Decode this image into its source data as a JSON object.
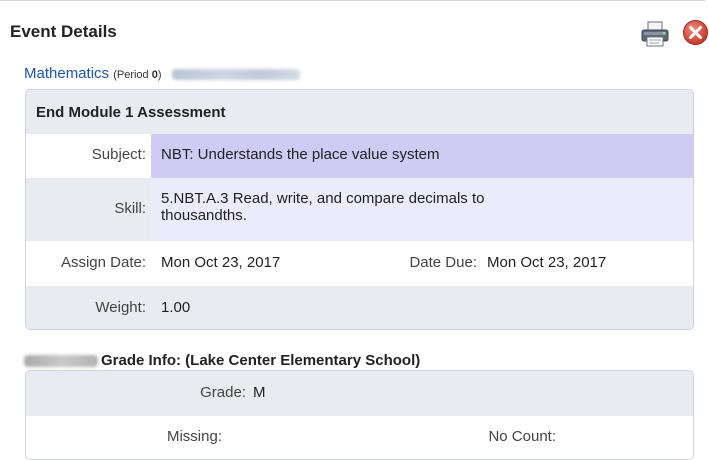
{
  "header": {
    "title": "Event Details",
    "icons": [
      "printer-icon",
      "close-icon"
    ]
  },
  "class_line": {
    "class_name": "Mathematics",
    "period_prefix": "(Period ",
    "period_number": "0",
    "period_suffix": ")"
  },
  "event": {
    "title": "End Module 1 Assessment",
    "subject_label": "Subject:",
    "subject_value": "NBT: Understands the place value system",
    "skill_label": "Skill:",
    "skill_value_line1": "5.NBT.A.3 Read, write, and compare decimals to",
    "skill_value_line2": "thousandths.",
    "assign_date_label": "Assign Date:",
    "assign_date_value": "Mon Oct 23, 2017",
    "date_due_label": "Date Due:",
    "date_due_value": "Mon Oct 23, 2017",
    "weight_label": "Weight:",
    "weight_value": "1.00"
  },
  "grade_info": {
    "header": "Grade Info: (Lake Center Elementary School)",
    "grade_label": "Grade:",
    "grade_value": "M",
    "missing_label": "Missing:",
    "no_count_label": "No Count:"
  },
  "colors": {
    "link": "#1f56a8",
    "card_bg": "#e8ecf1",
    "subject_highlight": "#cfcbf5",
    "skill_highlight": "#ecebfb",
    "close_red": "#d9483b"
  }
}
